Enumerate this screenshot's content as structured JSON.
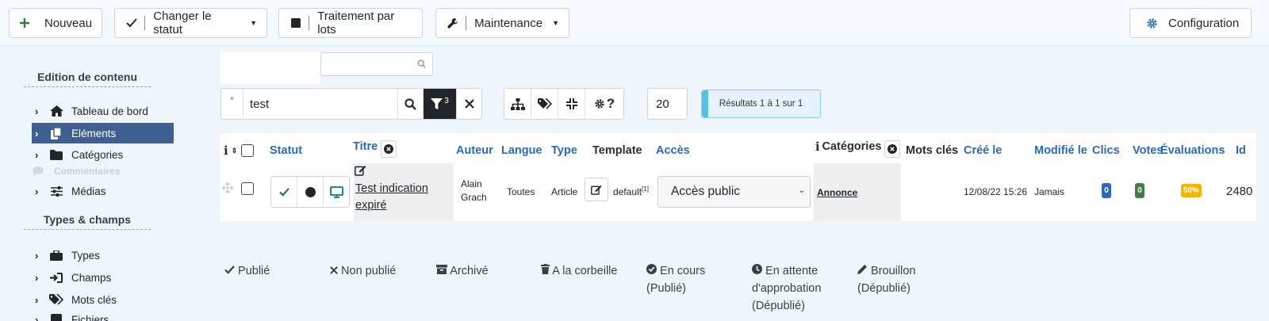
{
  "toolbar": {
    "new_label": "Nouveau",
    "status_label": "Changer le statut",
    "batch_label": "Traitement par lots",
    "maintenance_label": "Maintenance",
    "config_label": "Configuration"
  },
  "sidebar": {
    "section1": "Edition de contenu",
    "section2": "Types & champs",
    "items": [
      {
        "label": "Tableau de bord",
        "icon": "home-icon"
      },
      {
        "label": "Eléments",
        "icon": "copy-icon"
      },
      {
        "label": "Catégories",
        "icon": "folder-icon"
      },
      {
        "label": "Commentaires",
        "icon": "comment-icon"
      },
      {
        "label": "Médias",
        "icon": "sliders-icon"
      },
      {
        "label": "Types",
        "icon": "briefcase-icon"
      },
      {
        "label": "Champs",
        "icon": "sign-in-icon"
      },
      {
        "label": "Mots clés",
        "icon": "tags-icon"
      },
      {
        "label": "Fichiers",
        "icon": "file-icon"
      }
    ]
  },
  "filters": {
    "search_value": "test",
    "filter_count": "3",
    "limit": "20",
    "results": "Résultats 1 à 1 sur 1"
  },
  "table": {
    "headers": {
      "statut": "Statut",
      "titre": "Titre",
      "auteur": "Auteur",
      "langue": "Langue",
      "type": "Type",
      "template": "Template",
      "acces": "Accès",
      "categories": "Catégories",
      "mots_cles": "Mots clés",
      "cree": "Créé le",
      "modifie": "Modifié le",
      "clics": "Clics",
      "votes": "Votes",
      "evaluations": "Évaluations",
      "id": "Id"
    },
    "row": {
      "title_line1": "Test indication",
      "title_line2": "expiré",
      "author_line1": "Alain",
      "author_line2": "Grach",
      "language": "Toutes",
      "type": "Article",
      "template": "default",
      "template_sup": "[1]",
      "access": "Accès public",
      "category": "Annonce",
      "created": "12/08/22 15:26",
      "modified": "Jamais",
      "clicks": "0",
      "votes": "0",
      "rating": "50%",
      "id": "2480"
    }
  },
  "legend": {
    "published": "Publié",
    "unpublished": "Non publié",
    "archived": "Archivé",
    "trashed": "A la corbeille",
    "in_progress_1": "En cours",
    "in_progress_2": "(Publié)",
    "pending_1": "En attente",
    "pending_2": "d'approbation",
    "pending_3": "(Dépublié)",
    "draft_1": "Brouillon",
    "draft_2": "(Dépublié)"
  },
  "colors": {
    "accent": "#2a69b8",
    "active_nav": "#3e5f8f",
    "green": "#2e7d32",
    "teal": "#1b8a8a",
    "badge_blue": "#2a69b8",
    "badge_green": "#3d7f46",
    "badge_orange": "#f5b400"
  }
}
